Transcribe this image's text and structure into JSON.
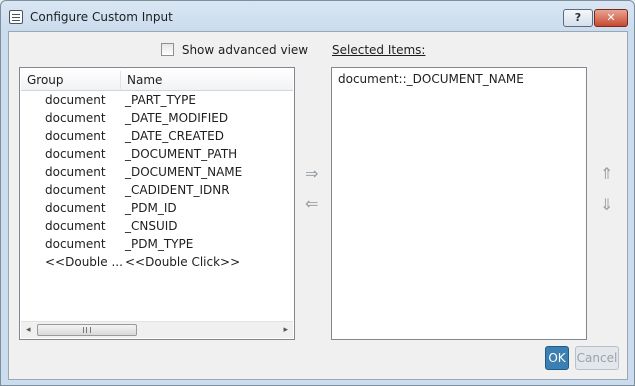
{
  "window": {
    "title": "Configure Custom Input",
    "help_label": "?",
    "close_label": "✕"
  },
  "options": {
    "show_advanced_label": "Show advanced view"
  },
  "available_list": {
    "columns": [
      "Group",
      "Name"
    ],
    "rows": [
      {
        "group": "document",
        "name": "_PART_TYPE"
      },
      {
        "group": "document",
        "name": "_DATE_MODIFIED"
      },
      {
        "group": "document",
        "name": "_DATE_CREATED"
      },
      {
        "group": "document",
        "name": "_DOCUMENT_PATH"
      },
      {
        "group": "document",
        "name": "_DOCUMENT_NAME"
      },
      {
        "group": "document",
        "name": "_CADIDENT_IDNR"
      },
      {
        "group": "document",
        "name": "_PDM_ID"
      },
      {
        "group": "document",
        "name": "_CNSUID"
      },
      {
        "group": "document",
        "name": "_PDM_TYPE"
      },
      {
        "group": "<<Double ...",
        "name": "<<Double Click>>"
      }
    ],
    "scroll_left_icon": "◂",
    "scroll_right_icon": "▸"
  },
  "transfer": {
    "add_icon": "⇒",
    "remove_icon": "⇐",
    "move_up_icon": "⇑",
    "move_down_icon": "⇓"
  },
  "selected": {
    "label": "Selected Items:",
    "items": [
      "document::_DOCUMENT_NAME"
    ]
  },
  "buttons": {
    "ok": "OK",
    "cancel": "Cancel"
  },
  "colors": {
    "ok_bg": "#3b7fb3",
    "close_bg": "#c64a32"
  }
}
